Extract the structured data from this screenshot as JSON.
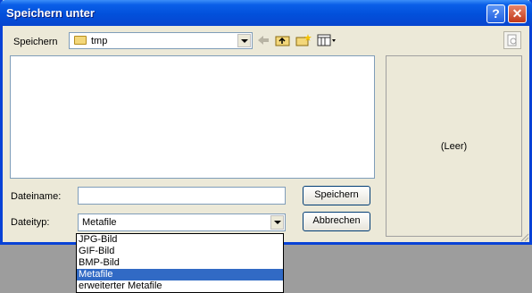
{
  "window": {
    "title": "Speichern unter",
    "help_glyph": "?",
    "close_glyph": "✕"
  },
  "toolbar": {
    "location_label": "Speichern",
    "location_value": "tmp",
    "back_icon": "left-arrow-icon",
    "up_icon": "folder-up-icon",
    "new_folder_icon": "new-folder-icon",
    "view_icon": "view-menu-icon"
  },
  "preview": {
    "empty_text": "(Leer)"
  },
  "form": {
    "filename_label": "Dateiname:",
    "filename_value": "",
    "filetype_label": "Dateityp:",
    "filetype_value": "Metafile",
    "save_button": "Speichern",
    "cancel_button": "Abbrechen"
  },
  "filetype_options": [
    {
      "label": "JPG-Bild",
      "selected": false
    },
    {
      "label": "GIF-Bild",
      "selected": false
    },
    {
      "label": "BMP-Bild",
      "selected": false
    },
    {
      "label": "Metafile",
      "selected": true
    },
    {
      "label": "erweiterter Metafile",
      "selected": false
    }
  ],
  "colors": {
    "title_bar": "#0a5fe8",
    "selection": "#316ac5",
    "dialog_bg": "#ece9d8"
  }
}
